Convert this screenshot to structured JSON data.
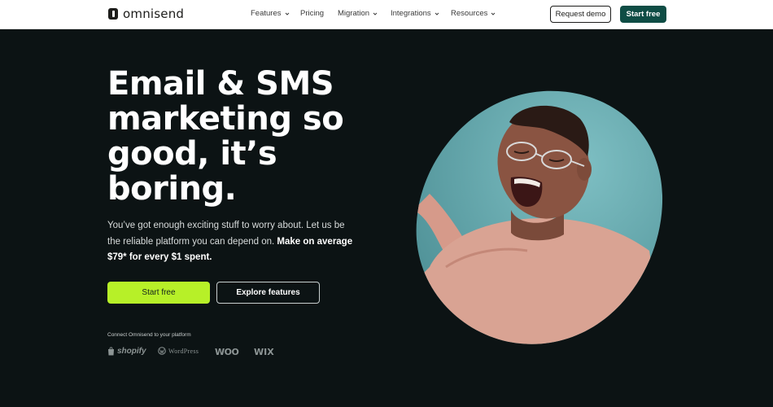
{
  "header": {
    "logo_text": "omnisend",
    "nav": [
      {
        "label": "Features",
        "has_dropdown": true
      },
      {
        "label": "Pricing",
        "has_dropdown": false
      },
      {
        "label": "Migration",
        "has_dropdown": true
      },
      {
        "label": "Integrations",
        "has_dropdown": true
      },
      {
        "label": "Resources",
        "has_dropdown": true
      }
    ],
    "request_demo_label": "Request demo",
    "start_free_label": "Start free"
  },
  "hero": {
    "title_lines": [
      "Email & SMS",
      "marketing so",
      "good, it’s",
      "boring."
    ],
    "subtitle_plain": "You’ve got enough exciting stuff to worry about. Let us be the reliable platform you can depend on. ",
    "subtitle_bold": "Make on average $79* for every $1 spent.",
    "start_free_label": "Start free",
    "explore_label": "Explore features",
    "connect_label": "Connect Omnisend to your platform",
    "platforms": [
      "shopify",
      "WordPress",
      "WOO",
      "WIX"
    ]
  },
  "colors": {
    "background": "#0c1314",
    "accent_green": "#b7f028",
    "brand_dark_green": "#0f4d45",
    "hero_circle": "#6fb0b5",
    "sweater": "#d9a393"
  },
  "icons": {
    "logo": "omnisend-logo-icon",
    "dropdown": "chevron-down-icon",
    "shopify": "shopify-bag-icon",
    "wordpress": "wordpress-icon"
  }
}
